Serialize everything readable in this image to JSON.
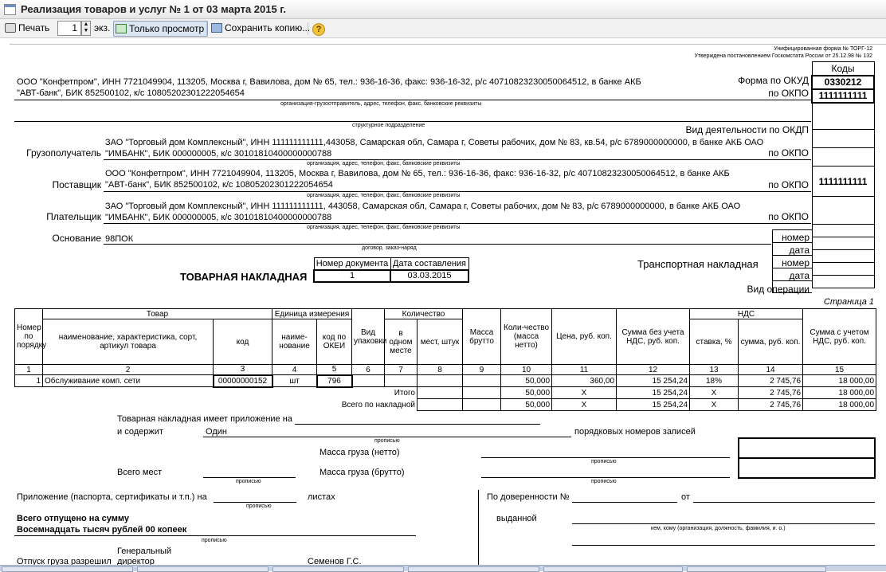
{
  "window": {
    "title": "Реализация товаров и услуг № 1 от 03 марта 2015 г."
  },
  "toolbar": {
    "print_label": "Печать",
    "copies_value": "1",
    "copies_unit": "экз.",
    "view_only_label": "Только просмотр",
    "save_copy_label": "Сохранить копию...",
    "help_label": "?"
  },
  "header": {
    "unified_form": "Унифицированная форма № ТОРГ-12",
    "approved": "Утверждена постановлением Госкомстата России от 25.12.98 № 132",
    "codes_title": "Коды",
    "okud_label": "Форма по ОКУД",
    "okud_value": "0330212",
    "okpo_label": "по ОКПО",
    "okpo_value": "1111111111",
    "okdp_label": "Вид деятельности по ОКДП",
    "consignee_okpo_label": "по ОКПО",
    "supplier_okpo_label": "по ОКПО",
    "supplier_okpo_value": "1111111111",
    "payer_okpo_label": "по ОКПО",
    "number_label": "номер",
    "date_label": "дата",
    "transport_label": "Транспортная накладная",
    "number_label2": "номер",
    "date_label2": "дата",
    "operation_label": "Вид операции"
  },
  "shipper": {
    "line1": "ООО \"Конфетпром\", ИНН 7721049904, 113205, Москва г, Вавилова, дом № 65, тел.: 936-16-36, факс: 936-16-32, р/с 40710823230050064512, в банке АКБ",
    "line2": "\"АВТ-банк\", БИК 852500102, к/с 10805202301222054654",
    "caption": "организация-грузоотправитель, адрес, телефон, факс, банковские реквизиты",
    "division_caption": "структурное подразделение"
  },
  "consignee": {
    "label": "Грузополучатель",
    "line1": "ЗАО \"Торговый дом Комплексный\", ИНН 111111111111,443058, Самарская обл, Самара г, Советы рабочих, дом № 83, кв.54, р/с 6789000000000, в банке АКБ ОАО",
    "line2": "\"ИМБАНК\", БИК 000000005, к/с 30101810400000000788",
    "caption": "организация, адрес, телефон, факс, банковские реквизиты"
  },
  "supplier": {
    "label": "Поставщик",
    "line1": "ООО \"Конфетпром\", ИНН 7721049904, 113205, Москва г, Вавилова, дом № 65, тел.: 936-16-36, факс: 936-16-32, р/с 40710823230050064512, в банке АКБ",
    "line2": "\"АВТ-банк\", БИК 852500102, к/с 10805202301222054654",
    "caption": "организация, адрес, телефон, факс, банковские реквизиты"
  },
  "payer": {
    "label": "Плательщик",
    "line1": "ЗАО \"Торговый дом Комплексный\", ИНН 111111111111, 443058, Самарская обл, Самара г, Советы рабочих, дом № 83, р/с 6789000000000, в банке АКБ ОАО",
    "line2": "\"ИМБАНК\", БИК 000000005, к/с 30101810400000000788",
    "caption": "организация, адрес, телефон, факс, банковские реквизиты"
  },
  "basis": {
    "label": "Основание",
    "value": "98ПОК",
    "caption": "договор, заказ-наряд"
  },
  "document": {
    "title": "ТОВАРНАЯ НАКЛАДНАЯ",
    "num_header": "Номер документа",
    "date_header": "Дата составления",
    "num_value": "1",
    "date_value": "03.03.2015"
  },
  "page": {
    "label": "Страница 1"
  },
  "table": {
    "h_num": "Номер по порядку",
    "h_goods": "Товар",
    "h_name": "наименование, характеристика, сорт, артикул товара",
    "h_code": "код",
    "h_unit": "Единица измерения",
    "h_unit_name": "наиме-нование",
    "h_okei": "код по ОКЕИ",
    "h_pack": "Вид упаковки",
    "h_qty": "Количество",
    "h_per_place": "в одном месте",
    "h_places": "мест, штук",
    "h_gross": "Масса брутто",
    "h_net": "Коли-чество (масса нетто)",
    "h_price": "Цена, руб. коп.",
    "h_sum_novat": "Сумма без учета НДС, руб. коп.",
    "h_vat": "НДС",
    "h_rate": "ставка, %",
    "h_vat_sum": "сумма, руб. коп.",
    "h_total": "Сумма с учетом НДС, руб. коп.",
    "col_nums": [
      "1",
      "2",
      "3",
      "4",
      "5",
      "6",
      "7",
      "8",
      "9",
      "10",
      "11",
      "12",
      "13",
      "14",
      "15"
    ],
    "rows": [
      {
        "n": "1",
        "name": "Обслуживание комп. сети",
        "code": "00000000152",
        "unit": "шт",
        "okei": "796",
        "pack": "",
        "per_place": "",
        "places": "",
        "gross": "",
        "net": "50,000",
        "price": "360,00",
        "sum": "15 254,24",
        "rate": "18%",
        "vat": "2 745,76",
        "total": "18 000,00"
      }
    ],
    "itogo": {
      "label": "Итого",
      "net": "50,000",
      "price": "X",
      "sum": "15 254,24",
      "rate": "X",
      "vat": "2 745,76",
      "total": "18 000,00"
    },
    "vsego": {
      "label": "Всего по накладной",
      "net": "50,000",
      "price": "X",
      "sum": "15 254,24",
      "rate": "X",
      "vat": "2 745,76",
      "total": "18 000,00"
    }
  },
  "footer": {
    "appendix_line1": "Товарная накладная имеет приложение на",
    "appendix_line2": "и содержит",
    "records_count": "Один",
    "records_label": "порядковых номеров записей",
    "propis1": "прописью",
    "net_mass_label": "Масса груза (нетто)",
    "propis2": "прописью",
    "places_label": "Всего мест",
    "propis3": "прописью",
    "gross_mass_label": "Масса груза (брутто)",
    "propis4": "прописью",
    "attachment_label": "Приложение (паспорта, сертификаты и т.п.) на",
    "sheets_label": "листах",
    "propis5": "прописью",
    "released_label": "Всего отпущено  на сумму",
    "released_value": "Восемнадцать тысяч рублей 00 копеек",
    "propis6": "прописью",
    "proxy_label": "По доверенности №",
    "from_label": "от",
    "issued_label": "выданной",
    "issued_caption": "кем, кому (организация, должность, фамилия, и. о.)",
    "general_label": "Генеральный",
    "cargo_permit": "Отпуск груза разрешил",
    "director_label": "директор",
    "director_name": "Семенов Г.С."
  }
}
